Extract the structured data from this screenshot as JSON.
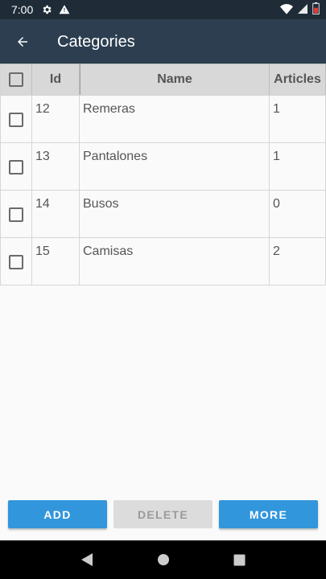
{
  "status_bar": {
    "time": "7:00"
  },
  "app_bar": {
    "title": "Categories"
  },
  "table": {
    "headers": {
      "id": "Id",
      "name": "Name",
      "articles": "Articles"
    },
    "rows": [
      {
        "id": "12",
        "name": "Remeras",
        "articles": "1"
      },
      {
        "id": "13",
        "name": "Pantalones",
        "articles": "1"
      },
      {
        "id": "14",
        "name": "Busos",
        "articles": "0"
      },
      {
        "id": "15",
        "name": "Camisas",
        "articles": "2"
      }
    ]
  },
  "buttons": {
    "add": "ADD",
    "delete": "DELETE",
    "more": "MORE"
  },
  "colors": {
    "primary": "#2c3e50",
    "status": "#1f2c38",
    "accent": "#3296dc",
    "disabled": "#dcdcdc"
  }
}
